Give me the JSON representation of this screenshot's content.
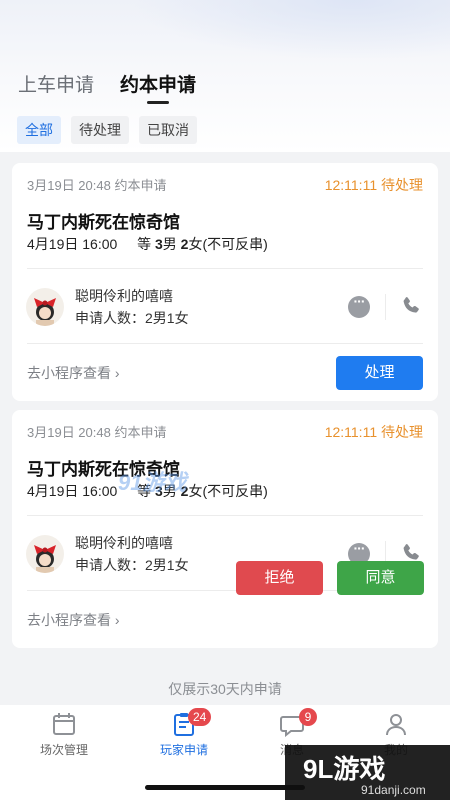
{
  "header": {
    "tabs": [
      {
        "label": "上车申请",
        "active": false
      },
      {
        "label": "约本申请",
        "active": true
      }
    ]
  },
  "filters": [
    {
      "label": "全部",
      "active": true
    },
    {
      "label": "待处理",
      "active": false
    },
    {
      "label": "已取消",
      "active": false
    }
  ],
  "requests": [
    {
      "meta": "3月19日 20:48 约本申请",
      "status": "12:11:11 待处理",
      "title": "马丁内斯死在惊奇馆",
      "time": "4月19日 16:00",
      "players_prefix": "等",
      "male_count": "3",
      "male_label": "男",
      "female_count": "2",
      "female_label": "女",
      "players_suffix": "(不可反串)",
      "user_name": "聪明伶利的嘻嘻",
      "applicant_count": "申请人数：2男1女",
      "mini_program_link": "去小程序查看",
      "action": "处理"
    },
    {
      "meta": "3月19日 20:48 约本申请",
      "status": "12:11:11 待处理",
      "title": "马丁内斯死在惊奇馆",
      "time": "4月19日 16:00",
      "players_prefix": "等",
      "male_count": "3",
      "male_label": "男",
      "female_count": "2",
      "female_label": "女",
      "players_suffix": "(不可反串)",
      "user_name": "聪明伶利的嘻嘻",
      "applicant_count": "申请人数：2男1女",
      "mini_program_link": "去小程序查看",
      "reject": "拒绝",
      "accept": "同意"
    }
  ],
  "footer_note": "仅展示30天内申请",
  "bottom_nav": [
    {
      "label": "场次管理",
      "icon": "calendar-icon",
      "badge": ""
    },
    {
      "label": "玩家申请",
      "icon": "clipboard-icon",
      "badge": "24"
    },
    {
      "label": "消息",
      "icon": "chat-icon",
      "badge": "9"
    },
    {
      "label": "我的",
      "icon": "profile-icon",
      "badge": ""
    }
  ],
  "watermark": {
    "mid": "91游戏",
    "title": "9L游戏",
    "url": "91danji.com"
  },
  "colors": {
    "accent": "#1f7cf0",
    "pending": "#e8912d",
    "reject": "#e04a4f",
    "accept": "#3ea548"
  }
}
